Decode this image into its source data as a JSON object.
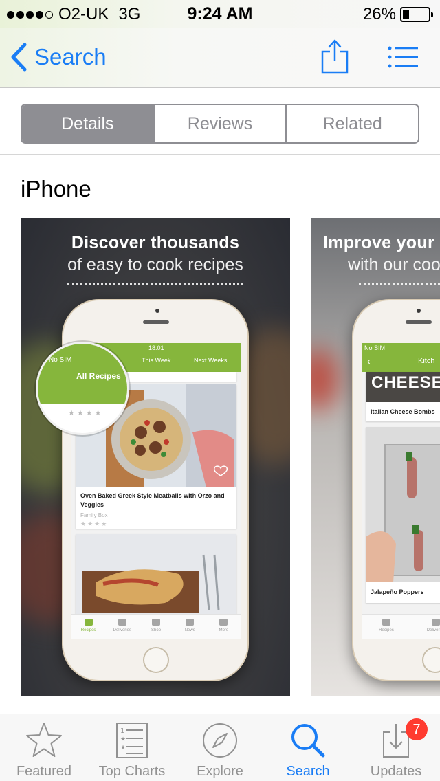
{
  "status_bar": {
    "carrier": "O2-UK",
    "network": "3G",
    "time": "9:24 AM",
    "battery_percent": "26%",
    "battery_level": 0.26,
    "signal_bars": 4
  },
  "nav": {
    "back_label": "Search",
    "tint_color": "#1a7df5"
  },
  "segments": [
    {
      "label": "Details",
      "selected": true
    },
    {
      "label": "Reviews",
      "selected": false
    },
    {
      "label": "Related",
      "selected": false
    }
  ],
  "section_title": "iPhone",
  "screenshots": [
    {
      "headline_bold": "Discover thousands",
      "headline_light": "of easy to cook recipes",
      "app": {
        "carrier": "No SIM",
        "time": "18:01",
        "tabs": [
          "All Recipes",
          "This Week",
          "Next Weeks"
        ],
        "cards": [
          {
            "title": "Oven Baked Greek Style Meatballs with Orzo and Veggies",
            "subtitle": "Family Box",
            "stars": "★★★★"
          },
          {
            "title": "",
            "subtitle": "",
            "stars": ""
          }
        ],
        "top_stars": "★★★★",
        "tabbar": [
          "Recipes",
          "Deliveries",
          "Shop",
          "News",
          "More"
        ]
      }
    },
    {
      "headline_bold": "Improve your",
      "headline_light": "with our coo",
      "app": {
        "carrier": "No SIM",
        "header_title": "Kitch",
        "banner_text": "CHEESE",
        "cards": [
          {
            "title": "Italian Cheese Bombs"
          },
          {
            "title": "Jalapeño Poppers"
          }
        ],
        "tabbar": [
          "Recipes",
          "Deliveries"
        ]
      }
    }
  ],
  "tab_bar": [
    {
      "label": "Featured",
      "icon": "star-icon",
      "active": false
    },
    {
      "label": "Top Charts",
      "icon": "list-icon",
      "active": false
    },
    {
      "label": "Explore",
      "icon": "compass-icon",
      "active": false
    },
    {
      "label": "Search",
      "icon": "search-icon",
      "active": true
    },
    {
      "label": "Updates",
      "icon": "download-icon",
      "active": false,
      "badge": "7"
    }
  ]
}
